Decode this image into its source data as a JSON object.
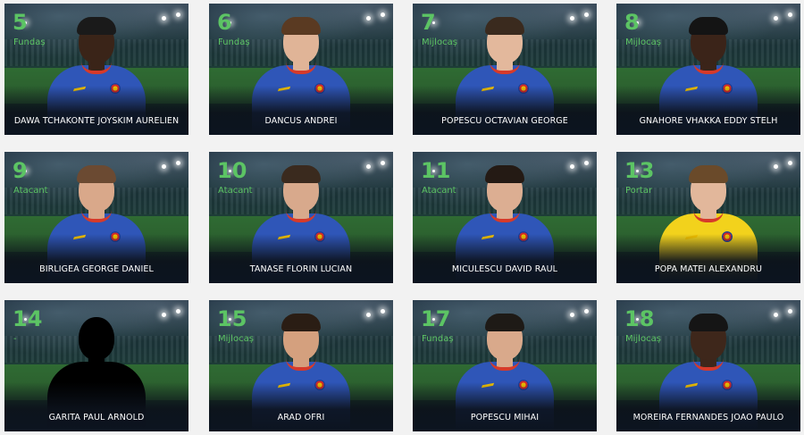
{
  "players": [
    {
      "number": "5",
      "position": "Fundaș",
      "name": "DAWA TCHAKONTE JOYSKIM AURELIEN",
      "kit": "blue",
      "skin": "#3a2418",
      "hair": "#1a1a1a"
    },
    {
      "number": "6",
      "position": "Fundaș",
      "name": "DANCUS ANDREI",
      "kit": "blue",
      "skin": "#e0b497",
      "hair": "#5a3a22"
    },
    {
      "number": "7",
      "position": "Mijlocaș",
      "name": "POPESCU OCTAVIAN GEORGE",
      "kit": "blue",
      "skin": "#e3b89c",
      "hair": "#3a2a1e"
    },
    {
      "number": "8",
      "position": "Mijlocaș",
      "name": "GNAHORE VHAKKA EDDY STELH",
      "kit": "blue",
      "skin": "#3b2419",
      "hair": "#141414"
    },
    {
      "number": "9",
      "position": "Atacant",
      "name": "BIRLIGEA GEORGE DANIEL",
      "kit": "blue",
      "skin": "#d9a88a",
      "hair": "#6b4a32"
    },
    {
      "number": "10",
      "position": "Atacant",
      "name": "TANASE FLORIN LUCIAN",
      "kit": "blue",
      "skin": "#d8a98c",
      "hair": "#3a2a1e"
    },
    {
      "number": "11",
      "position": "Atacant",
      "name": "MICULESCU DAVID RAUL",
      "kit": "blue",
      "skin": "#dcae92",
      "hair": "#241a14"
    },
    {
      "number": "13",
      "position": "Portar",
      "name": "POPA MATEI ALEXANDRU",
      "kit": "yellow",
      "skin": "#e2b79b",
      "hair": "#6a4a2a"
    },
    {
      "number": "14",
      "position": "-",
      "name": "GARITA PAUL ARNOLD",
      "kit": "silhouette",
      "skin": "#000000",
      "hair": "#000000"
    },
    {
      "number": "15",
      "position": "Mijlocaș",
      "name": "ARAD OFRI",
      "kit": "blue",
      "skin": "#d4a07e",
      "hair": "#2a1d14"
    },
    {
      "number": "17",
      "position": "Fundaș",
      "name": "POPESCU MIHAI",
      "kit": "blue",
      "skin": "#d9a98b",
      "hair": "#1e1a16"
    },
    {
      "number": "18",
      "position": "Mijlocaș",
      "name": "MOREIRA FERNANDES JOAO PAULO",
      "kit": "blue",
      "skin": "#3e271b",
      "hair": "#151515"
    }
  ],
  "colors": {
    "accent_green": "#5cc464",
    "kit_blue": "#2f56b8",
    "kit_yellow": "#f2d21c",
    "collar_red": "#d63a2a"
  }
}
